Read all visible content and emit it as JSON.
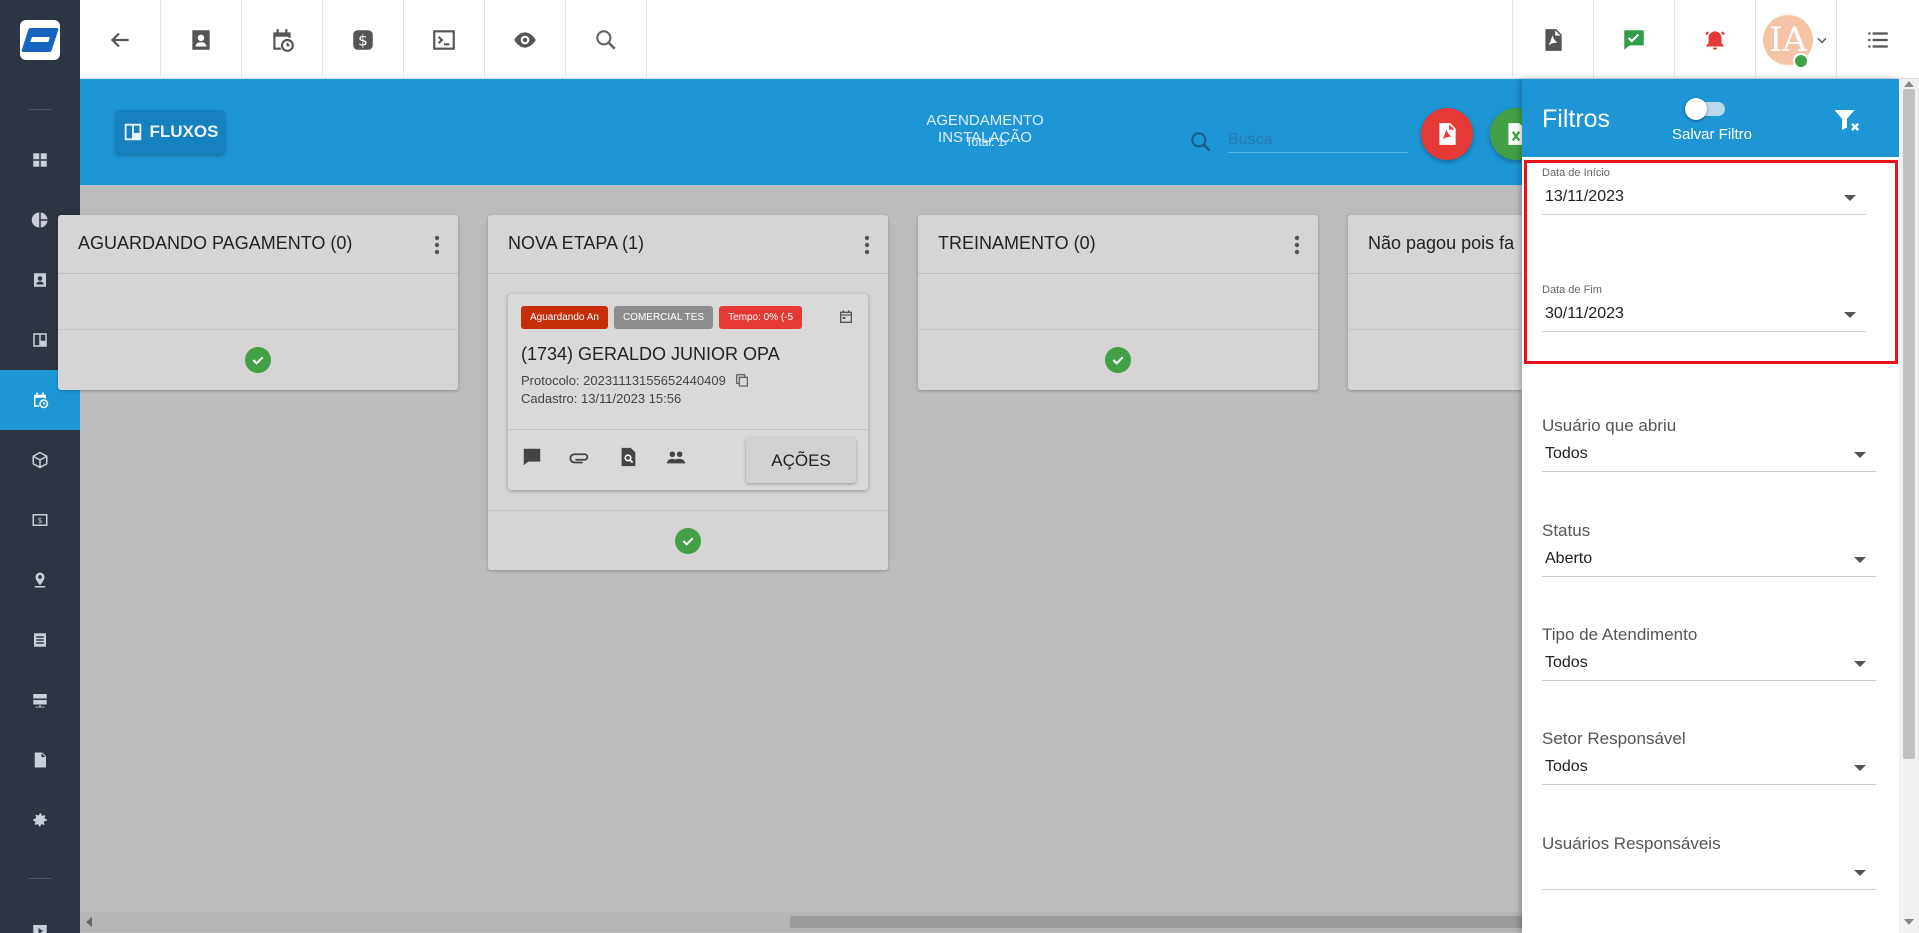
{
  "colors": {
    "primary": "#1e96d6",
    "sidebar": "#2d3442",
    "danger": "#e53935",
    "success": "#43a047",
    "highlight": "#e8121b"
  },
  "sidebar": {
    "items": [
      {
        "icon": "dashboard-icon"
      },
      {
        "icon": "pie-chart-icon"
      },
      {
        "icon": "contact-card-icon"
      },
      {
        "icon": "board-icon"
      },
      {
        "icon": "calendar-clock-icon",
        "active": true
      },
      {
        "icon": "box-icon"
      },
      {
        "icon": "money-icon"
      },
      {
        "icon": "location-icon"
      },
      {
        "icon": "list-icon"
      },
      {
        "icon": "server-icon"
      },
      {
        "icon": "document-icon"
      },
      {
        "icon": "gear-icon"
      },
      {
        "icon": "play-icon"
      }
    ]
  },
  "topbar": {
    "left_icons": [
      "back-arrow-icon",
      "contact-card-icon",
      "calendar-clock-icon",
      "dollar-icon",
      "terminal-icon",
      "eye-icon",
      "search-icon"
    ],
    "right_icons": [
      "pdf-icon",
      "chat-check-icon",
      "alarm-icon",
      "avatar",
      "menu-list-icon"
    ],
    "avatar_initials": "IA"
  },
  "header": {
    "fluxos_label": "FLUXOS",
    "title": "AGENDAMENTO INSTALAÇÃO",
    "total": "Total: 1",
    "search_placeholder": "Busca"
  },
  "columns": [
    {
      "title": "AGUARDANDO PAGAMENTO (0)"
    },
    {
      "title": "NOVA ETAPA (1)"
    },
    {
      "title": "TREINAMENTO (0)"
    },
    {
      "title": "Não pagou pois fa"
    }
  ],
  "card": {
    "tags": [
      {
        "label": "Aguardando An",
        "color": "#c62e0a"
      },
      {
        "label": "COMERCIAL TES",
        "color": "#8d8d8d"
      },
      {
        "label": "Tempo: 0% (-5",
        "color": "#e53935"
      }
    ],
    "title": "(1734) GERALDO JUNIOR OPA",
    "protocolo": "Protocolo: 20231113155652440409",
    "cadastro": "Cadastro: 13/11/2023 15:56",
    "actions_label": "AÇÕES"
  },
  "filters": {
    "title": "Filtros",
    "save_filter_label": "Salvar Filtro",
    "save_filter_on": false,
    "fields": [
      {
        "label": "Data de Início",
        "value": "13/11/2023"
      },
      {
        "label": "Data de Fim",
        "value": "30/11/2023"
      },
      {
        "label": "Usuário que abriu",
        "value": "Todos"
      },
      {
        "label": "Status",
        "value": "Aberto"
      },
      {
        "label": "Tipo de Atendimento",
        "value": "Todos"
      },
      {
        "label": "Setor Responsável",
        "value": "Todos"
      },
      {
        "label": "Usuários Responsáveis",
        "value": ""
      }
    ]
  }
}
